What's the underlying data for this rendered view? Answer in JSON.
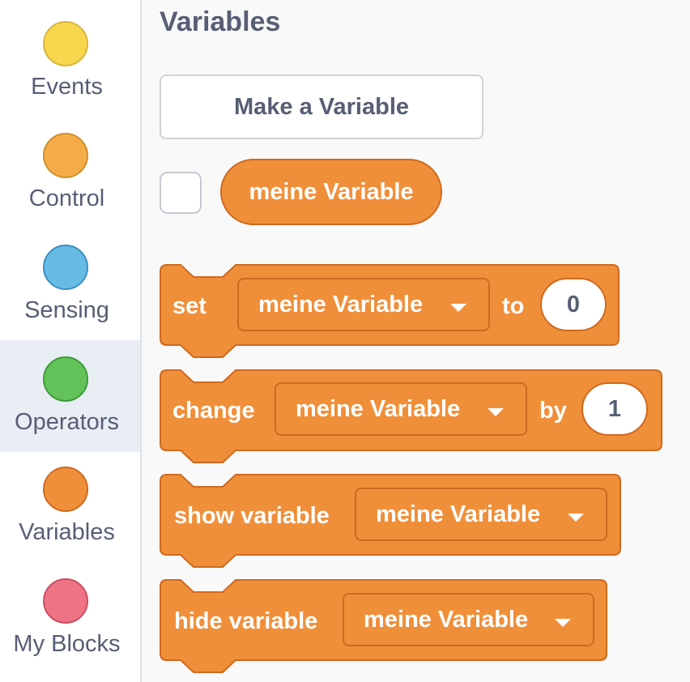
{
  "sidebar": {
    "categories": [
      {
        "label": "Events",
        "color": "#f8d64e",
        "border": "#d9b63a",
        "selected": false
      },
      {
        "label": "Control",
        "color": "#f5ac48",
        "border": "#d08f2c",
        "selected": false
      },
      {
        "label": "Sensing",
        "color": "#67bce6",
        "border": "#3b8fc1",
        "selected": false
      },
      {
        "label": "Operators",
        "color": "#63c25a",
        "border": "#3b9b36",
        "selected": true
      },
      {
        "label": "Variables",
        "color": "#f08f3a",
        "border": "#cf6a1f",
        "selected": false
      },
      {
        "label": "My Blocks",
        "color": "#ee7384",
        "border": "#cd4f62",
        "selected": false
      }
    ]
  },
  "palette": {
    "title": "Variables",
    "make_variable_label": "Make a Variable",
    "variable_reporter": "meine Variable",
    "block_color": "#f08f3a",
    "block_border": "#cf6a1f",
    "blocks": {
      "set": {
        "prefix": "set",
        "dropdown": "meine Variable",
        "middle": "to",
        "value": "0"
      },
      "change": {
        "prefix": "change",
        "dropdown": "meine Variable",
        "middle": "by",
        "value": "1"
      },
      "show": {
        "prefix": "show variable",
        "dropdown": "meine Variable"
      },
      "hide": {
        "prefix": "hide variable",
        "dropdown": "meine Variable"
      }
    }
  }
}
